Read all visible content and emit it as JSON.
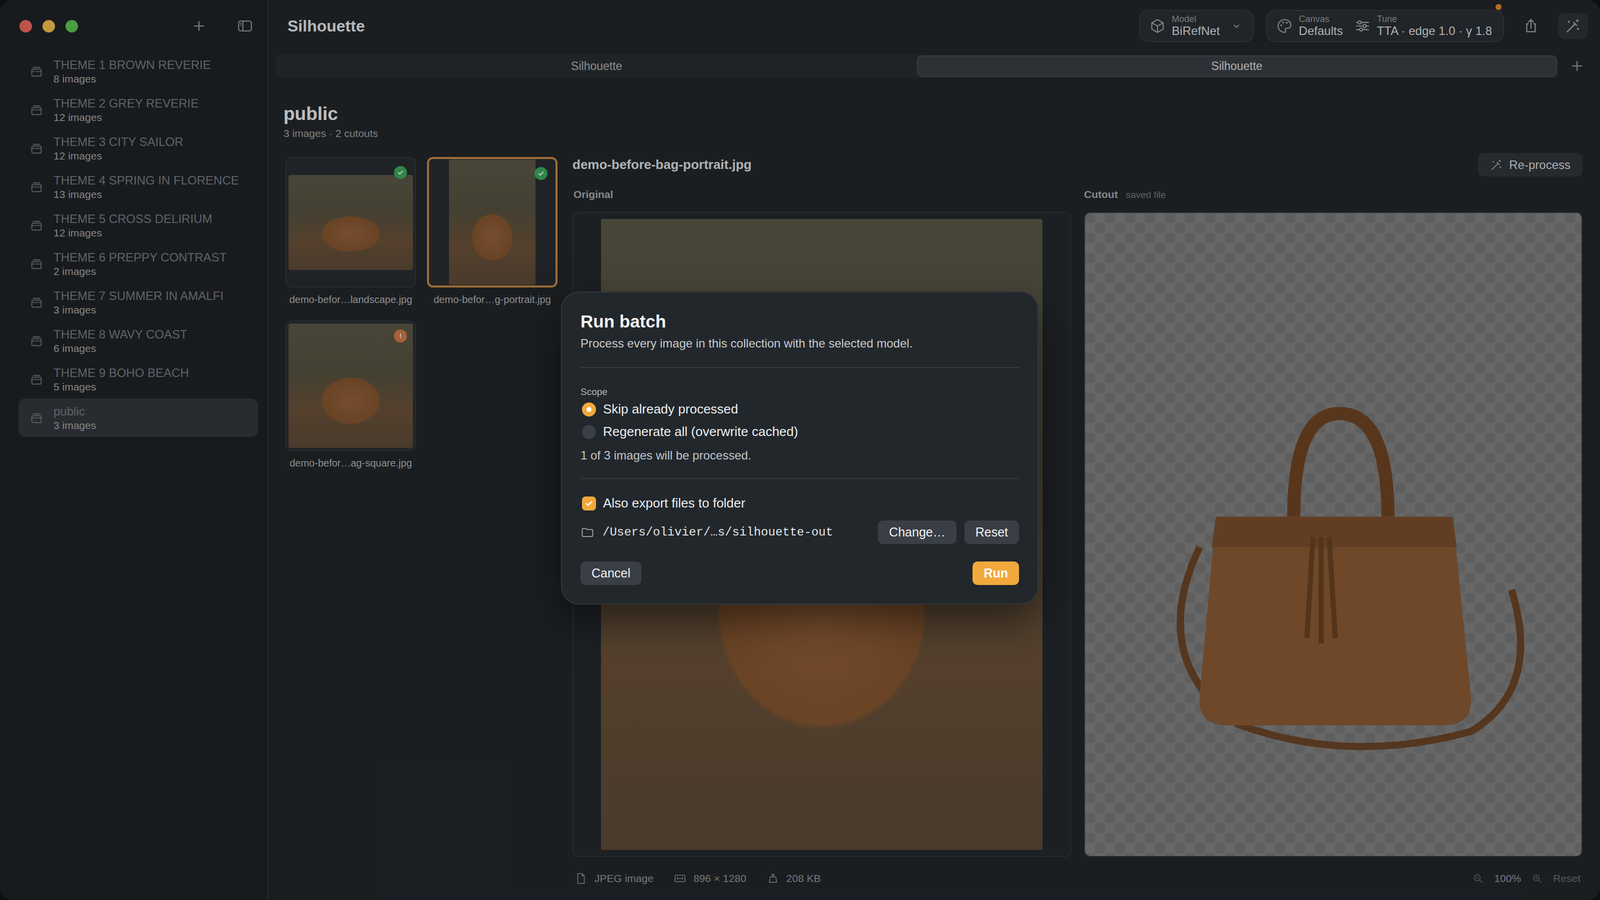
{
  "window": {
    "title": "Silhouette"
  },
  "toolbar": {
    "model": {
      "label": "Model",
      "value": "BiRefNet"
    },
    "canvas": {
      "label": "Canvas",
      "value": "Defaults"
    },
    "tune": {
      "label": "Tune",
      "value": "TTA · edge 1.0 · γ 1.8"
    },
    "update_dot": true
  },
  "tabs": [
    {
      "label": "Silhouette",
      "selected": false
    },
    {
      "label": "Silhouette",
      "selected": true
    }
  ],
  "sidebar": {
    "items": [
      {
        "name": "THEME 1 BROWN REVERIE",
        "count": "8 images",
        "selected": false
      },
      {
        "name": "THEME 2 GREY REVERIE",
        "count": "12 images",
        "selected": false
      },
      {
        "name": "THEME 3 CITY SAILOR",
        "count": "12 images",
        "selected": false
      },
      {
        "name": "THEME 4 SPRING IN FLORENCE",
        "count": "13 images",
        "selected": false
      },
      {
        "name": "THEME 5 CROSS DELIRIUM",
        "count": "12 images",
        "selected": false
      },
      {
        "name": "THEME 6 PREPPY CONTRAST",
        "count": "2 images",
        "selected": false
      },
      {
        "name": "THEME 7 SUMMER IN AMALFI",
        "count": "3 images",
        "selected": false
      },
      {
        "name": "THEME 8 WAVY COAST",
        "count": "6 images",
        "selected": false
      },
      {
        "name": "THEME 9 BOHO BEACH",
        "count": "5 images",
        "selected": false
      },
      {
        "name": "public",
        "count": "3 images",
        "selected": true
      }
    ]
  },
  "collection": {
    "title": "public",
    "summary": "3 images · 2 cutouts"
  },
  "thumbnails": [
    {
      "label": "demo-befor…landscape.jpg",
      "processed": true,
      "selected": false,
      "kind": "landscape"
    },
    {
      "label": "demo-befor…g-portrait.jpg",
      "processed": true,
      "selected": true,
      "kind": "portrait"
    },
    {
      "label": "demo-befor…ag-square.jpg",
      "processed": false,
      "selected": false,
      "kind": "square"
    }
  ],
  "detail": {
    "filename": "demo-before-bag-portrait.jpg",
    "reprocess": "Re-process",
    "original_label": "Original",
    "cutout_label": "Cutout",
    "cutout_note": "saved file"
  },
  "status_bar": {
    "format": "JPEG image",
    "dimensions": "896 × 1280",
    "size": "208 KB",
    "zoom": "100%",
    "reset": "Reset",
    "reset_disabled": true
  },
  "dialog": {
    "title": "Run batch",
    "description": "Process every image in this collection with the selected model.",
    "scope_label": "Scope",
    "options": [
      {
        "label": "Skip already processed",
        "selected": true
      },
      {
        "label": "Regenerate all (overwrite cached)",
        "selected": false
      }
    ],
    "summary": "1 of 3 images will be processed.",
    "export": {
      "label": "Also export files to folder",
      "checked": true
    },
    "path": "/Users/olivier/…s/silhouette-out",
    "change": "Change…",
    "reset": "Reset",
    "cancel": "Cancel",
    "run": "Run"
  }
}
